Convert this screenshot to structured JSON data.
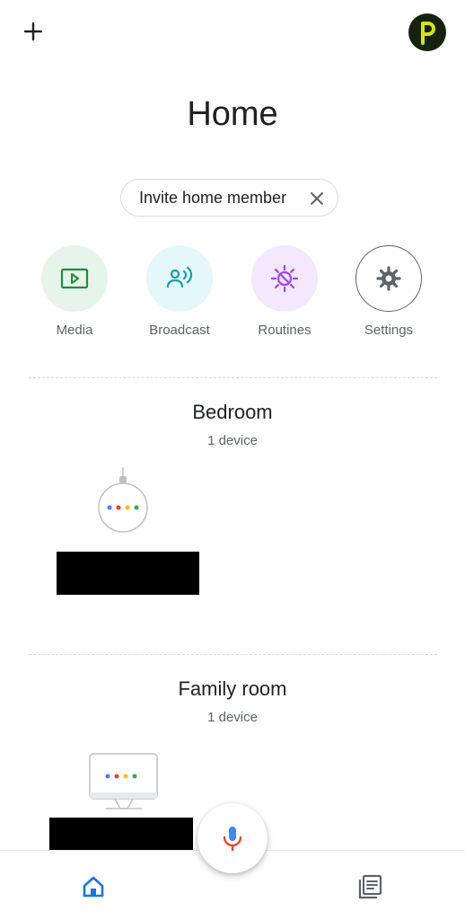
{
  "header": {
    "add_icon": "plus-icon",
    "avatar_letter": "p",
    "title": "Home"
  },
  "invite_chip": {
    "label": "Invite home member",
    "close_icon": "close-icon"
  },
  "actions": [
    {
      "label": "Media",
      "icon": "play-screen-icon",
      "bg": "#e6f4ea",
      "color": "#1e8e3e"
    },
    {
      "label": "Broadcast",
      "icon": "broadcast-person-icon",
      "bg": "#e4f7fb",
      "color": "#129eaf"
    },
    {
      "label": "Routines",
      "icon": "routines-sun-icon",
      "bg": "#f3e8fd",
      "color": "#a142f4"
    },
    {
      "label": "Settings",
      "icon": "gear-icon",
      "bg": "#ffffff",
      "color": "#5f6368"
    }
  ],
  "rooms": [
    {
      "name": "Bedroom",
      "count": "1 device",
      "device_icon": "speaker-icon"
    },
    {
      "name": "Family room",
      "count": "1 device",
      "device_icon": "display-icon"
    }
  ],
  "bottom_nav": {
    "home_icon": "home-icon",
    "mic_icon": "mic-icon",
    "feed_icon": "feed-icon"
  },
  "colors": {
    "accent_blue": "#1a73e8",
    "google_blue": "#4285f4",
    "google_red": "#ea4335",
    "google_yellow": "#fbbc04",
    "google_green": "#34a853",
    "avatar_bg": "#15230d",
    "avatar_fg": "#d7e21a"
  }
}
